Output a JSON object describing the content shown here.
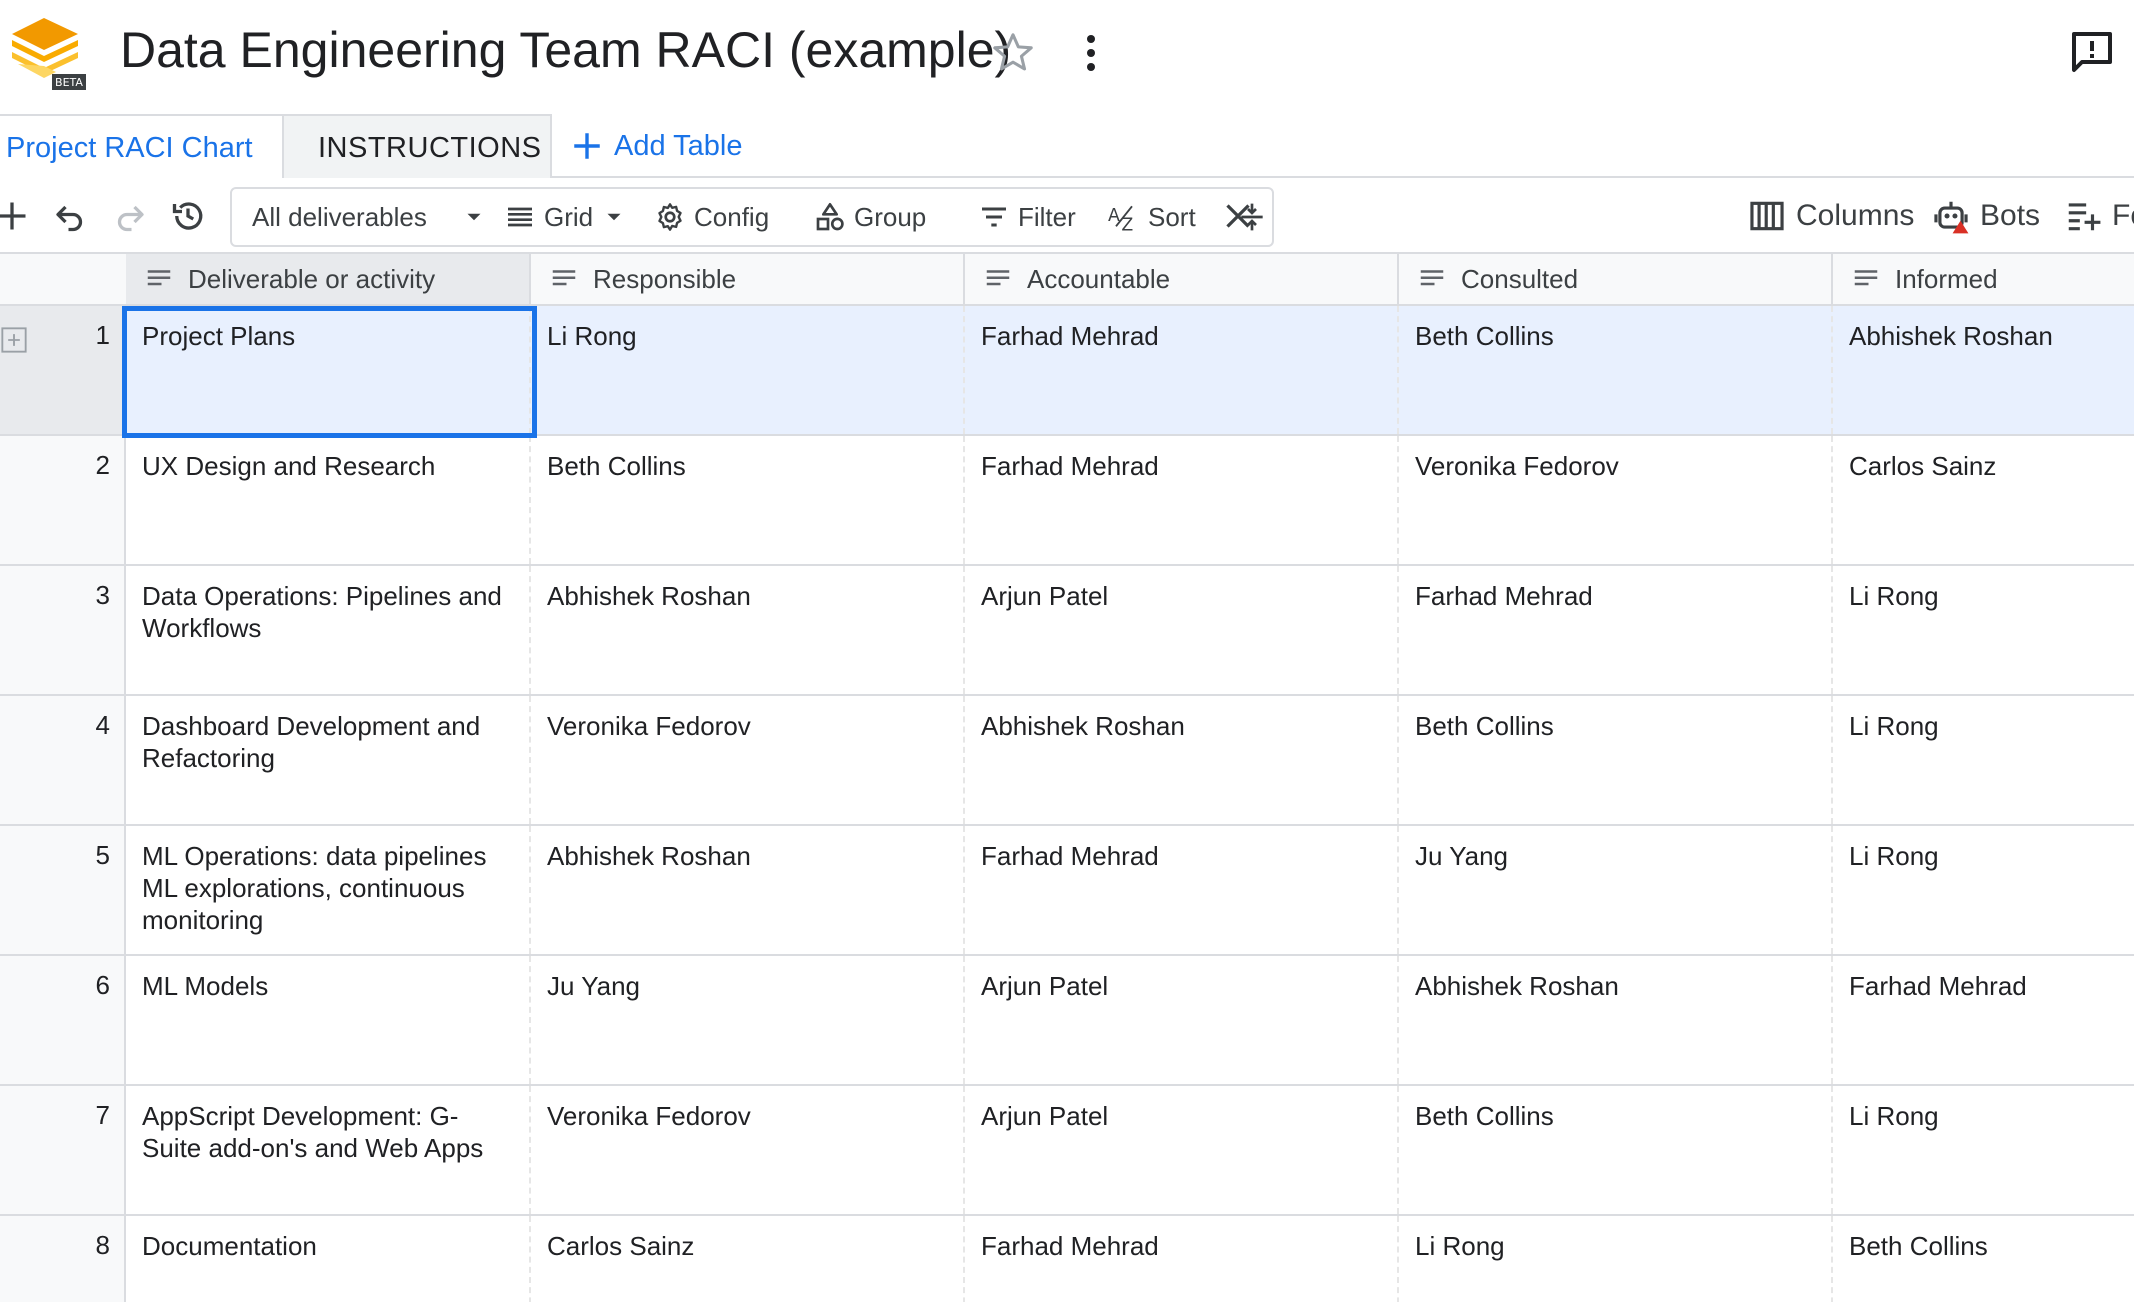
{
  "header": {
    "title": "Data Engineering Team RACI (example)",
    "beta_badge": "BETA"
  },
  "tabs": {
    "items": [
      "Project RACI Chart",
      "INSTRUCTIONS"
    ],
    "add_label": "Add Table"
  },
  "toolbar": {
    "view_select": "All deliverables",
    "grid": "Grid",
    "config": "Config",
    "group": "Group",
    "filter": "Filter",
    "sort": "Sort",
    "columns": "Columns",
    "bots": "Bots",
    "forms": "Fo"
  },
  "table": {
    "headers": [
      "Deliverable or activity",
      "Responsible",
      "Accountable",
      "Consulted",
      "Informed"
    ],
    "rows": [
      {
        "num": "1",
        "cells": [
          "Project Plans",
          "Li Rong",
          "Farhad Mehrad",
          "Beth Collins",
          "Abhishek Roshan"
        ]
      },
      {
        "num": "2",
        "cells": [
          "UX Design and Research",
          "Beth Collins",
          "Farhad Mehrad",
          "Veronika Fedorov",
          "Carlos Sainz"
        ]
      },
      {
        "num": "3",
        "cells": [
          "Data Operations: Pipelines and Workflows",
          "Abhishek Roshan",
          "Arjun Patel",
          "Farhad Mehrad",
          "Li Rong"
        ]
      },
      {
        "num": "4",
        "cells": [
          "Dashboard Development and Refactoring",
          "Veronika Fedorov",
          "Abhishek Roshan",
          "Beth Collins",
          "Li Rong"
        ]
      },
      {
        "num": "5",
        "cells": [
          "ML Operations: data pipelines ML explorations, continuous monitoring",
          "Abhishek Roshan",
          "Farhad Mehrad",
          "Ju Yang",
          "Li Rong"
        ]
      },
      {
        "num": "6",
        "cells": [
          "ML Models",
          "Ju Yang",
          "Arjun Patel",
          "Abhishek Roshan",
          "Farhad Mehrad"
        ]
      },
      {
        "num": "7",
        "cells": [
          "AppScript Development: G-Suite add-on's and Web Apps",
          "Veronika Fedorov",
          "Arjun Patel",
          "Beth Collins",
          "Li Rong"
        ]
      },
      {
        "num": "8",
        "cells": [
          "Documentation",
          "Carlos Sainz",
          "Farhad Mehrad",
          "Li Rong",
          "Beth Collins"
        ]
      }
    ]
  },
  "colors": {
    "accent": "#1a73e8",
    "selected_row": "#e8f0fe",
    "logo_orange": "#f29900",
    "alert_red": "#d93025"
  }
}
